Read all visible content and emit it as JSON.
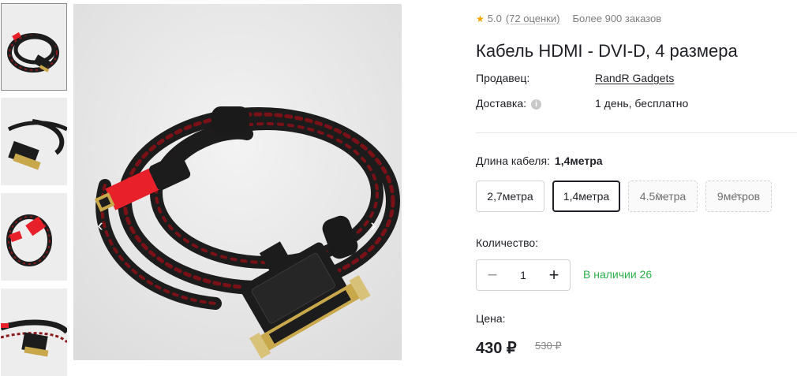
{
  "gallery": {
    "thumbnail_count": 4,
    "active_thumbnail": 0,
    "prev_icon": "‹",
    "next_icon": "›"
  },
  "product": {
    "rating": "5.0",
    "reviews_link": "(72 оценки)",
    "orders": "Более 900 заказов",
    "title": "Кабель HDMI - DVI-D, 4 размера",
    "seller_label": "Продавец:",
    "seller_name": "RandR Gadgets",
    "delivery_label": "Доставка:",
    "delivery_value": "1 день, бесплатно",
    "length_label": "Длина кабеля:",
    "length_selected": "1,4метра",
    "options": [
      {
        "label": "2,7метра",
        "state": "available"
      },
      {
        "label": "1,4метра",
        "state": "selected"
      },
      {
        "label": "4.5метра",
        "state": "unavailable"
      },
      {
        "label": "9метров",
        "state": "unavailable"
      }
    ],
    "quantity_label": "Количество:",
    "quantity_value": "1",
    "stock_text": "В наличии 26",
    "price_label": "Цена:",
    "price": "430 ₽",
    "old_price": "530 ₽"
  },
  "colors": {
    "star": "#f0a500",
    "stock_green": "#2cb14a",
    "cable_red": "#e8202a",
    "cable_black": "#1c1c1c"
  }
}
